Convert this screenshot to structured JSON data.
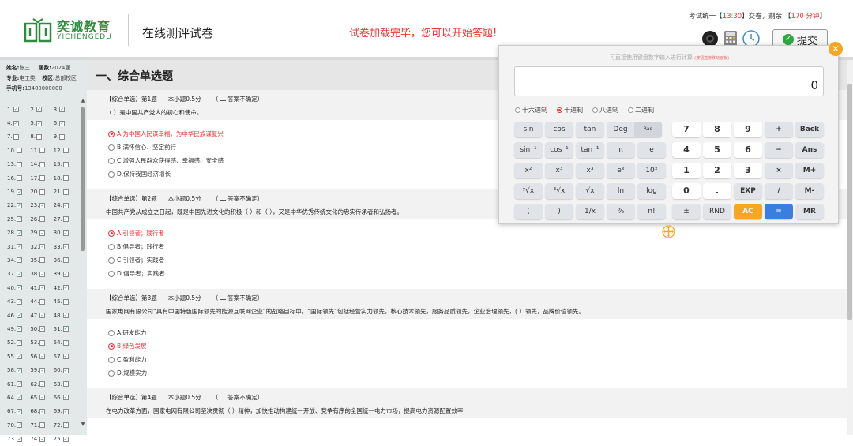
{
  "header": {
    "logo_cn": "奕诚教育",
    "logo_en": "YICHENGEDU",
    "title": "在线测评试卷",
    "message": "试卷加载完毕，您可以开始答题!",
    "timer_prefix": "考试统一【",
    "timer_time": "13:30",
    "timer_mid": "】交卷，剩余:【",
    "timer_remaining": "170 分钟",
    "timer_suffix": "】",
    "submit_label": "提交"
  },
  "sidebar": {
    "name_label": "姓名:",
    "name": "张三",
    "grade_label": "届数:",
    "grade": "2024届",
    "major_label": "专业:",
    "major": "电工类",
    "campus_label": "校区:",
    "campus": "总部校区",
    "phone_label": "手机号:",
    "phone": "13400000000"
  },
  "question_nav": [
    {
      "n": "1.",
      "done": true
    },
    {
      "n": "2.",
      "done": true
    },
    {
      "n": "3.",
      "done": true
    },
    {
      "n": "4.",
      "done": true
    },
    {
      "n": "5.",
      "done": true
    },
    {
      "n": "6.",
      "done": true
    },
    {
      "n": "7.",
      "done": false
    },
    {
      "n": "8.",
      "done": false
    },
    {
      "n": "9.",
      "done": false
    },
    {
      "n": "10.",
      "done": false
    },
    {
      "n": "11.",
      "done": false
    },
    {
      "n": "12.",
      "done": false
    },
    {
      "n": "13.",
      "done": false
    },
    {
      "n": "14.",
      "done": false
    },
    {
      "n": "15.",
      "done": false
    },
    {
      "n": "16.",
      "done": false
    },
    {
      "n": "17.",
      "done": false
    },
    {
      "n": "18.",
      "done": false
    },
    {
      "n": "19.",
      "done": true
    },
    {
      "n": "20.",
      "done": false
    },
    {
      "n": "21.",
      "done": false
    },
    {
      "n": "22.",
      "done": true
    },
    {
      "n": "23.",
      "done": true
    },
    {
      "n": "24.",
      "done": true
    },
    {
      "n": "25.",
      "done": true
    },
    {
      "n": "26.",
      "done": true
    },
    {
      "n": "27.",
      "done": true
    },
    {
      "n": "28.",
      "done": true
    },
    {
      "n": "29.",
      "done": true
    },
    {
      "n": "30.",
      "done": true
    },
    {
      "n": "31.",
      "done": true
    },
    {
      "n": "32.",
      "done": true
    },
    {
      "n": "33.",
      "done": true
    },
    {
      "n": "34.",
      "done": true
    },
    {
      "n": "35.",
      "done": true
    },
    {
      "n": "36.",
      "done": true
    },
    {
      "n": "37.",
      "done": true
    },
    {
      "n": "38.",
      "done": true
    },
    {
      "n": "39.",
      "done": true
    },
    {
      "n": "40.",
      "done": true
    },
    {
      "n": "41.",
      "done": true
    },
    {
      "n": "42.",
      "done": true
    },
    {
      "n": "43.",
      "done": true
    },
    {
      "n": "44.",
      "done": true
    },
    {
      "n": "45.",
      "done": true
    },
    {
      "n": "46.",
      "done": true
    },
    {
      "n": "47.",
      "done": true
    },
    {
      "n": "48.",
      "done": true
    },
    {
      "n": "49.",
      "done": true
    },
    {
      "n": "50.",
      "done": true
    },
    {
      "n": "51.",
      "done": true
    },
    {
      "n": "52.",
      "done": true
    },
    {
      "n": "53.",
      "done": true
    },
    {
      "n": "54.",
      "done": true
    },
    {
      "n": "55.",
      "done": true
    },
    {
      "n": "56.",
      "done": true
    },
    {
      "n": "57.",
      "done": true
    },
    {
      "n": "58.",
      "done": true
    },
    {
      "n": "59.",
      "done": true
    },
    {
      "n": "60.",
      "done": true
    },
    {
      "n": "61.",
      "done": true
    },
    {
      "n": "62.",
      "done": true
    },
    {
      "n": "63.",
      "done": true
    },
    {
      "n": "64.",
      "done": true
    },
    {
      "n": "65.",
      "done": true
    },
    {
      "n": "66.",
      "done": true
    },
    {
      "n": "67.",
      "done": true
    },
    {
      "n": "68.",
      "done": true
    },
    {
      "n": "69.",
      "done": true
    },
    {
      "n": "70.",
      "done": true
    },
    {
      "n": "71.",
      "done": true
    },
    {
      "n": "72.",
      "done": true
    },
    {
      "n": "73.",
      "done": true
    },
    {
      "n": "74.",
      "done": true
    },
    {
      "n": "75.",
      "done": true
    }
  ],
  "section_title": "一、综合单选题",
  "uncertain_label": "答案不确定",
  "questions": [
    {
      "type": "【综合单选】",
      "num": "第1题",
      "score": "本小题0.5分",
      "stem": "（   ）是中国共产党人的初心和使命。",
      "options": [
        {
          "text": "A.为中国人民谋幸福，为中华民族谋复兴",
          "selected": true
        },
        {
          "text": "B.满怀信心、坚定前行",
          "selected": false
        },
        {
          "text": "C.增强人民群众获得感、幸福感、安全感",
          "selected": false
        },
        {
          "text": "D.保持我国经济增长",
          "selected": false
        }
      ]
    },
    {
      "type": "【综合单选】",
      "num": "第2题",
      "score": "本小题0.5分",
      "stem": "中国共产党从成立之日起，既是中国先进文化的积极（   ）和（   ），又是中华优秀传统文化的忠实传承者和弘扬者。",
      "options": [
        {
          "text": "A.引领者；践行者",
          "selected": true
        },
        {
          "text": "B.倡导者；践行者",
          "selected": false
        },
        {
          "text": "C.引领者；实践者",
          "selected": false
        },
        {
          "text": "D.倡导者；实践者",
          "selected": false
        }
      ]
    },
    {
      "type": "【综合单选】",
      "num": "第3题",
      "score": "本小题0.5分",
      "stem": "国家电网有限公司“具有中国特色国际领先的能源互联网企业”的战略目标中，“国际领先”包括经营实力领先，核心技术领先，服务品质领先，企业治理领先，(    ）领先，品牌价值领先。",
      "options": [
        {
          "text": "A.研发能力",
          "selected": false
        },
        {
          "text": "B.绿色发展",
          "selected": true
        },
        {
          "text": "C.盈利能力",
          "selected": false
        },
        {
          "text": "D.规模实力",
          "selected": false
        }
      ]
    },
    {
      "type": "【综合单选】",
      "num": "第4题",
      "score": "本小题0.5分",
      "stem": "在电力改革方面，国家电网有限公司坚决贯彻（   ）精神，加快推动构建统一开放、竞争有序的全国统一电力市场，提高电力资源配置效率",
      "options": []
    }
  ],
  "calculator": {
    "hint": "可直接使用键盘数字输入进行计算",
    "hint_small": "(按钮直接移动面板)",
    "display": "0",
    "bases": [
      {
        "label": "十六进制",
        "selected": false
      },
      {
        "label": "十进制",
        "selected": true
      },
      {
        "label": "八进制",
        "selected": false
      },
      {
        "label": "二进制",
        "selected": false
      }
    ],
    "rows": [
      [
        "sin",
        "cos",
        "tan",
        "Deg|Rad",
        "",
        "7",
        "8",
        "9",
        "+",
        "Back"
      ],
      [
        "sin⁻¹",
        "cos⁻¹",
        "tan⁻¹",
        "π",
        "e",
        "4",
        "5",
        "6",
        "−",
        "Ans"
      ],
      [
        "x²",
        "x³",
        "x³",
        "eˣ",
        "10ˣ",
        "1",
        "2",
        "3",
        "×",
        "M+"
      ],
      [
        "ʸ√x",
        "³√x",
        "√x",
        "ln",
        "log",
        "0",
        ".",
        "EXP",
        "/",
        "M-"
      ],
      [
        "(",
        ")",
        "1/x",
        "%",
        "n!",
        "±",
        "RND",
        "AC",
        "=",
        "MR"
      ]
    ]
  },
  "colors": {
    "brand_green": "#2e8b3d",
    "alert_red": "#e33333",
    "ac_orange": "#f5a623",
    "equals_blue": "#3a7fe0"
  }
}
